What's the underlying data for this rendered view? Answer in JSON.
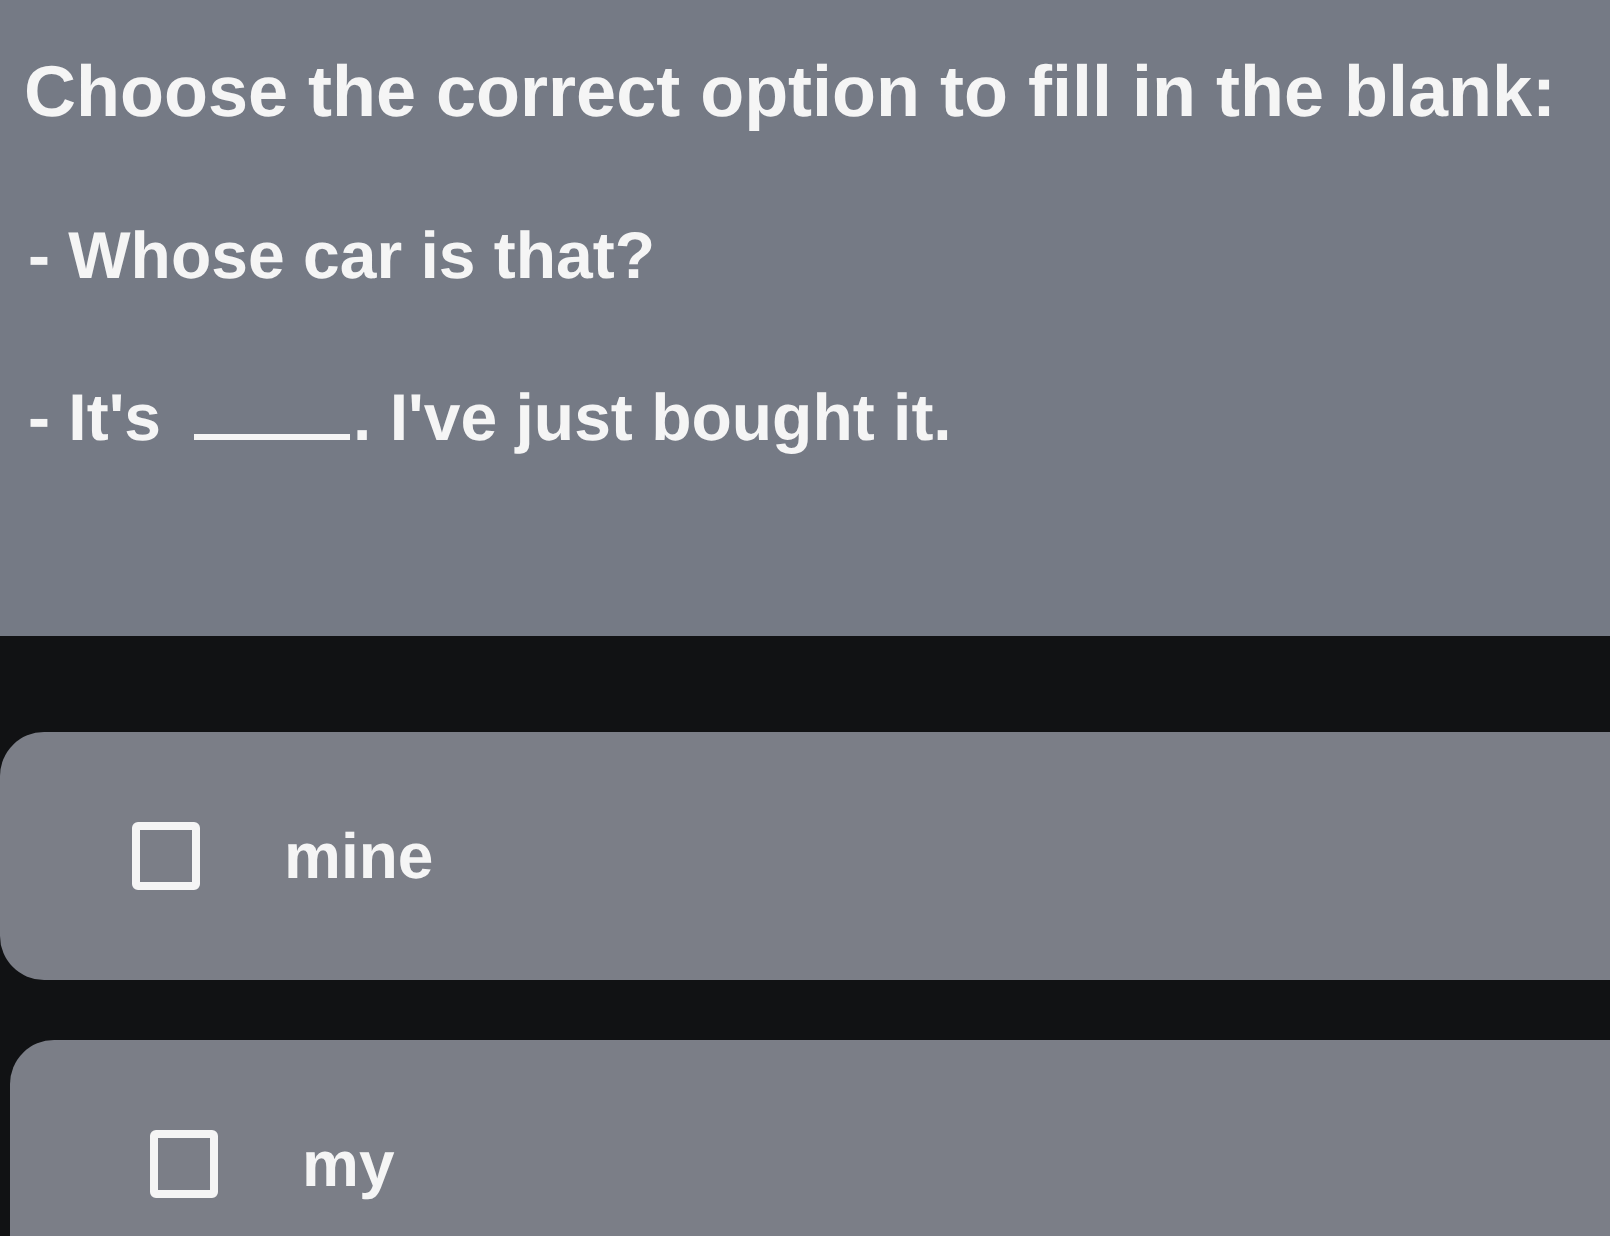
{
  "question": {
    "title": "Choose the correct option to fill in the blank:",
    "lines": [
      {
        "kind": "text",
        "text": "- Whose car is that?"
      },
      {
        "kind": "blank",
        "before": "- It's",
        "after": ". I've just bought it."
      }
    ]
  },
  "options": [
    {
      "label": "mine",
      "checked": false
    },
    {
      "label": "my",
      "checked": false
    }
  ]
}
